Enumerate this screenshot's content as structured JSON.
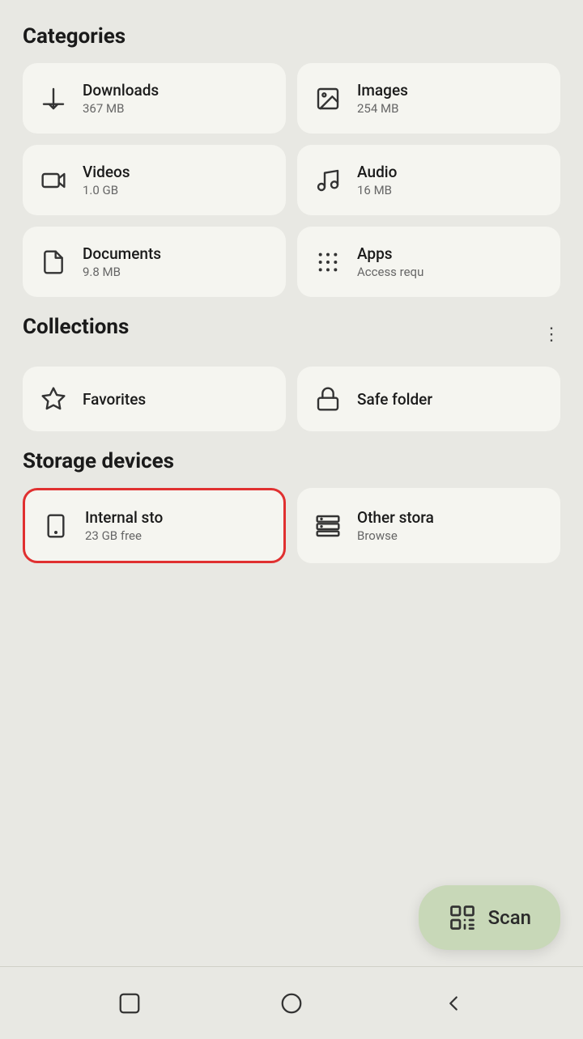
{
  "categories": {
    "title": "Categories",
    "items": [
      {
        "id": "downloads",
        "label": "Downloads",
        "sub": "367 MB",
        "icon": "download-icon"
      },
      {
        "id": "images",
        "label": "Images",
        "sub": "254 MB",
        "icon": "image-icon"
      },
      {
        "id": "videos",
        "label": "Videos",
        "sub": "1.0 GB",
        "icon": "video-icon"
      },
      {
        "id": "audio",
        "label": "Audio",
        "sub": "16 MB",
        "icon": "audio-icon"
      },
      {
        "id": "documents",
        "label": "Documents",
        "sub": "9.8 MB",
        "icon": "document-icon"
      },
      {
        "id": "apps",
        "label": "Apps",
        "sub": "Access requ",
        "icon": "apps-icon"
      }
    ]
  },
  "collections": {
    "title": "Collections",
    "items": [
      {
        "id": "favorites",
        "label": "Favorites",
        "icon": "star-icon"
      },
      {
        "id": "safe-folder",
        "label": "Safe folder",
        "icon": "lock-icon"
      }
    ]
  },
  "storage_devices": {
    "title": "Storage devices",
    "items": [
      {
        "id": "internal-storage",
        "label": "Internal sto",
        "sub": "23 GB free",
        "icon": "phone-icon",
        "highlighted": true
      },
      {
        "id": "other-storage",
        "label": "Other stora",
        "sub": "Browse",
        "icon": "server-icon",
        "highlighted": false
      }
    ]
  },
  "scan_fab": {
    "label": "Scan",
    "icon": "scan-icon"
  },
  "nav": {
    "items": [
      {
        "id": "square",
        "icon": "square-icon"
      },
      {
        "id": "circle",
        "icon": "circle-icon"
      },
      {
        "id": "back",
        "icon": "back-icon"
      }
    ]
  }
}
